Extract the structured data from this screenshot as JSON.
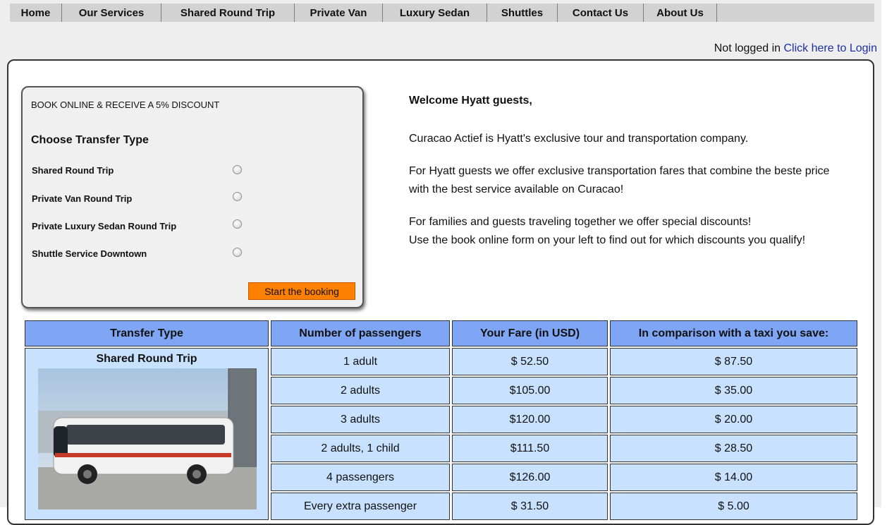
{
  "nav": {
    "items": [
      "Home",
      "Our Services",
      "Shared Round Trip",
      "Private Van",
      "Luxury Sedan",
      "Shuttles",
      "Contact Us",
      "About Us"
    ]
  },
  "login": {
    "status": "Not logged in",
    "link": "Click here to Login"
  },
  "booking": {
    "promo": "BOOK ONLINE & RECEIVE A 5% DISCOUNT",
    "heading": "Choose Transfer Type",
    "options": [
      "Shared Round Trip",
      "Private Van Round Trip",
      "Private Luxury Sedan Round Trip",
      "Shuttle Service Downtown"
    ],
    "button": "Start the booking",
    "button_color": "#ff7f00"
  },
  "welcome": {
    "heading": "Welcome Hyatt guests,",
    "p1": "Curacao Actief is Hyatt's exclusive tour and transportation company.",
    "p2": "For Hyatt guests we offer exclusive transportation fares that combine the beste price with the best service available on Curacao!",
    "p3a": "For families and guests traveling together we offer special discounts!",
    "p3b": "Use the book online form on your left to find out for which discounts you qualify!"
  },
  "table": {
    "headers": [
      "Transfer Type",
      "Number of passengers",
      "Your Fare (in USD)",
      "In comparison with a taxi you save:"
    ],
    "transfer_type": "Shared Round Trip",
    "rows": [
      {
        "passengers": "1 adult",
        "fare": "$  52.50",
        "save": "$ 87.50"
      },
      {
        "passengers": "2 adults",
        "fare": "$105.00",
        "save": "$ 35.00"
      },
      {
        "passengers": "3 adults",
        "fare": "$120.00",
        "save": "$ 20.00"
      },
      {
        "passengers": "2 adults, 1 child",
        "fare": "$111.50",
        "save": "$ 28.50"
      },
      {
        "passengers": "4 passengers",
        "fare": "$126.00",
        "save": "$ 14.00"
      },
      {
        "passengers": "Every extra passenger",
        "fare": "$  31.50",
        "save": "$   5.00"
      }
    ],
    "header_color": "#7fa5f5",
    "cell_color": "#c8e1ff"
  }
}
